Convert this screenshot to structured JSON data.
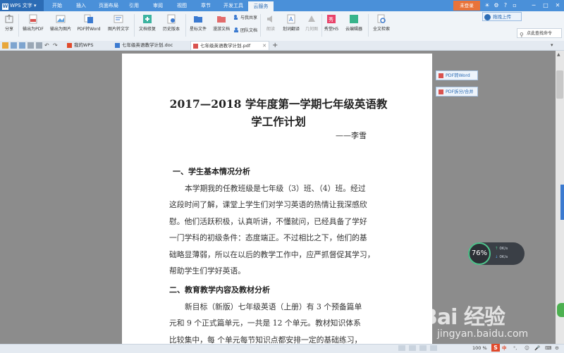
{
  "app": {
    "name": "WPS 文字",
    "logo_letter": "W"
  },
  "menu": {
    "tabs": [
      "开始",
      "插入",
      "页面布局",
      "引用",
      "审阅",
      "视图",
      "章节",
      "开发工具",
      "云服务"
    ],
    "active_tab": "云服务",
    "login_label": "未登录"
  },
  "ribbon": {
    "upload_label": "拖拽上传",
    "buttons": {
      "share": "分享",
      "export_pdf": "输出为PDF",
      "export_image": "输出为图片",
      "pdf_to_word": "PDF转Word",
      "image_to_text": "图片转文字",
      "doc_repair": "文档修复",
      "history": "历史版本",
      "starred": "星标文件",
      "roaming": "漫游文档",
      "share_with_me": "与我共享",
      "team_docs": "团队文档",
      "read": "朗读",
      "translate": "划词翻译",
      "geometry": "几何图",
      "xiuke_h5": "秀堂H5",
      "yun_editor": "云编辑器",
      "fulltext_search": "全文检索"
    },
    "search_placeholder": "点此查找命令"
  },
  "tabbar": {
    "my_wps": "我的WPS",
    "tabs": [
      {
        "label": "七年级英语教学计划.doc",
        "active": false
      },
      {
        "label": "七年级英语教学计划.pdf",
        "active": true
      }
    ]
  },
  "document": {
    "title_line1": "2017—2018 学年度第一学期七年级英语教",
    "title_line2": "学工作计划",
    "author": "——李雪",
    "section1_heading": "一、学生基本情况分析",
    "section1_lines": [
      "本学期我的任教班级是七年级（3）班、（4）班。经过",
      "这段时间了解，课堂上学生们对学习英语的热情让我深感欣",
      "慰。他们活跃积极，认真听讲，不懂就问，已经具备了学好",
      "一门学科的初级条件：态度端正。不过相比之下，他们的基",
      "础略显薄弱，所以在以后的教学工作中，应严抓督促其学习，",
      "帮助学生们学好英语。"
    ],
    "section2_heading": "二、教育教学内容及教材分析",
    "section2_lines": [
      "新目标（新版）七年级英语（上册）有 3 个预备篇单",
      "元和 9 个正式篇单元，一共是 12 个单元。教材知识体系",
      "比较集中，每 个单元每节知识点都安排一定的基础练习，"
    ]
  },
  "side_tools": {
    "pdf_to_word": "PDF转Word",
    "pdf_split_merge": "PDF拆分/合并"
  },
  "net_widget": {
    "percent": "76%",
    "upload_speed": "0K/s",
    "download_speed": "0K/s"
  },
  "statusbar": {
    "zoom": "100 %",
    "ime_label": "S",
    "ime_mode": "中"
  },
  "watermark": {
    "logo": "Bai 经验",
    "url": "jingyan.baidu.com"
  },
  "colors": {
    "menubar": "#4a90d9",
    "login": "#e8733a",
    "accent": "#2c6cb5"
  }
}
